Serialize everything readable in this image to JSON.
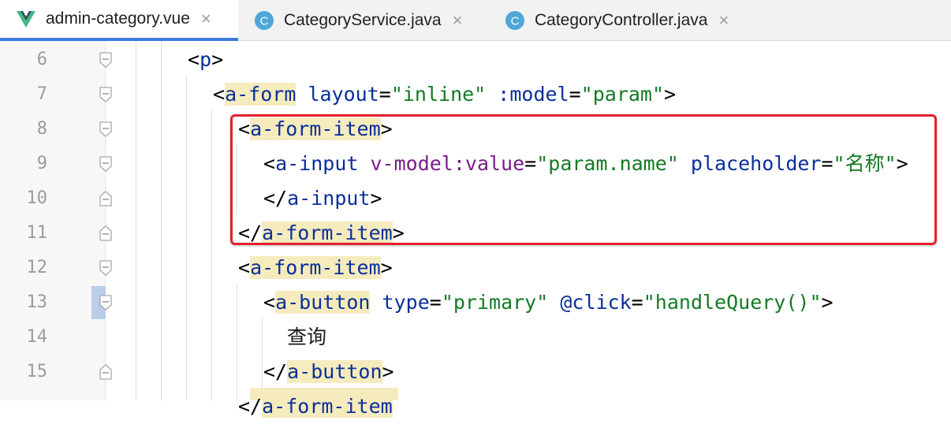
{
  "tabs": [
    {
      "label": "admin-category.vue",
      "icon": "vue-icon",
      "active": true
    },
    {
      "label": "CategoryService.java",
      "icon": "java-class-icon",
      "active": false
    },
    {
      "label": "CategoryController.java",
      "icon": "java-class-icon",
      "active": false
    }
  ],
  "tab_close_glyph": "×",
  "class_icon_letter": "C",
  "line_numbers": [
    "6",
    "7",
    "8",
    "9",
    "10",
    "11",
    "12",
    "13",
    "14",
    "15"
  ],
  "code": {
    "line6": {
      "open": "<",
      "tag": "p",
      "close": ">"
    },
    "line7": {
      "open": "<",
      "tag": "a-form",
      "attr1": "layout",
      "eq1": "=",
      "val1": "\"inline\"",
      "attr2": ":model",
      "eq2": "=",
      "val2": "\"param\"",
      "close": ">"
    },
    "line8": {
      "open": "<",
      "tag": "a-form-item",
      "close": ">"
    },
    "line9": {
      "open": "<",
      "tag": "a-input",
      "vattr": "v-model:value",
      "eq1": "=",
      "val1": "\"param.name\"",
      "attr2": "placeholder",
      "eq2": "=",
      "val2": "\"名称\"",
      "close": ">"
    },
    "line10": {
      "open": "</",
      "tag": "a-input",
      "close": ">"
    },
    "line11": {
      "open": "</",
      "tag": "a-form-item",
      "close": ">"
    },
    "line12": {
      "open": "<",
      "tag": "a-form-item",
      "close": ">"
    },
    "line13": {
      "open": "<",
      "tag": "a-button",
      "attr1": "type",
      "eq1": "=",
      "val1": "\"primary\"",
      "attr2": "@click",
      "eq2": "=",
      "val2": "\"handleQuery()\"",
      "close": ">"
    },
    "line14": {
      "text": "查询"
    },
    "line15": {
      "open": "</",
      "tag": "a-button",
      "close": ">"
    },
    "line16": {
      "open": "</",
      "tag": "a-form-item"
    }
  },
  "colors": {
    "tag": "#0a2f9a",
    "string": "#147a24",
    "vue_attr": "#7a1c8c",
    "highlight": "#f5ebbd",
    "selection_border": "#e3212b",
    "active_tab_underline": "#3c7bd6"
  }
}
